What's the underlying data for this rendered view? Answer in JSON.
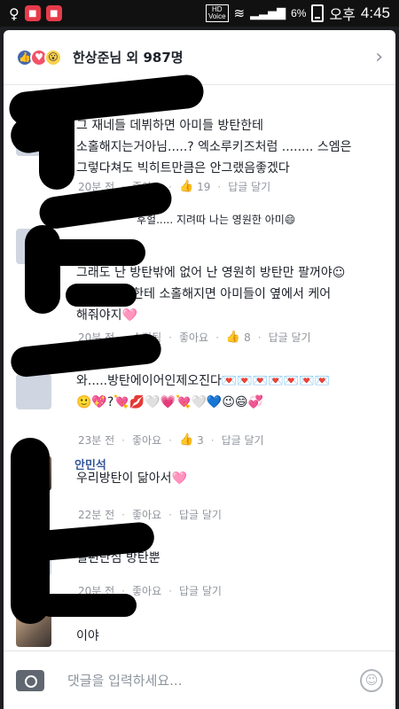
{
  "status": {
    "hd": "HD",
    "voice": "Voice",
    "battery": "6%",
    "ampm": "오후",
    "time": "4:45"
  },
  "header": {
    "title": "한상준님 외 987명",
    "reaction_icons": [
      "like-icon",
      "love-icon",
      "wow-icon"
    ]
  },
  "comments": [
    {
      "name": "",
      "text": "그 재네들 데뷔하면 아미들 방탄한테\n소홀해지는거아님.....? 엑소루키즈처럼 ........ 스엠은\n그렇다쳐도 빅히트만큼은 안그랬음좋겠다",
      "time": "20분 전",
      "like": "좋아요",
      "likes": "19",
      "reply": "답글 달기"
    },
    {
      "name": "",
      "partial": "후헐..... 지려따 나는 영원한 아미😄",
      "text": "그래도 난 방탄밖에 없어 난 영원히 방탄만 팔꺼야☺\n+방틴이들한테 소홀해지면 아미들이 옆에서 케어\n해줘야지🩷",
      "time": "20분 전",
      "edited": "수정됨",
      "like": "좋아요",
      "likes": "8",
      "reply": "답글 달기"
    },
    {
      "name": "",
      "text": "와.....방탄에이어인제오진다💌💌💌💌💌💌💌\n🙂💖?💘💋🤍💗💘🤍💙😉😄💞",
      "time": "23분 전",
      "like": "좋아요",
      "likes": "3",
      "reply": "답글 달기"
    },
    {
      "name": "안민석",
      "text": "우리방탄이 닮아서🩷",
      "time": "22분 전",
      "like": "좋아요",
      "reply": "답글 달기"
    },
    {
      "name": "",
      "text": "일편단심 방탄뿐",
      "time": "20분 전",
      "like": "좋아요",
      "reply": "답글 달기"
    },
    {
      "name": "",
      "text": "이야"
    }
  ],
  "compose": {
    "placeholder": "댓글을 입력하세요..."
  }
}
